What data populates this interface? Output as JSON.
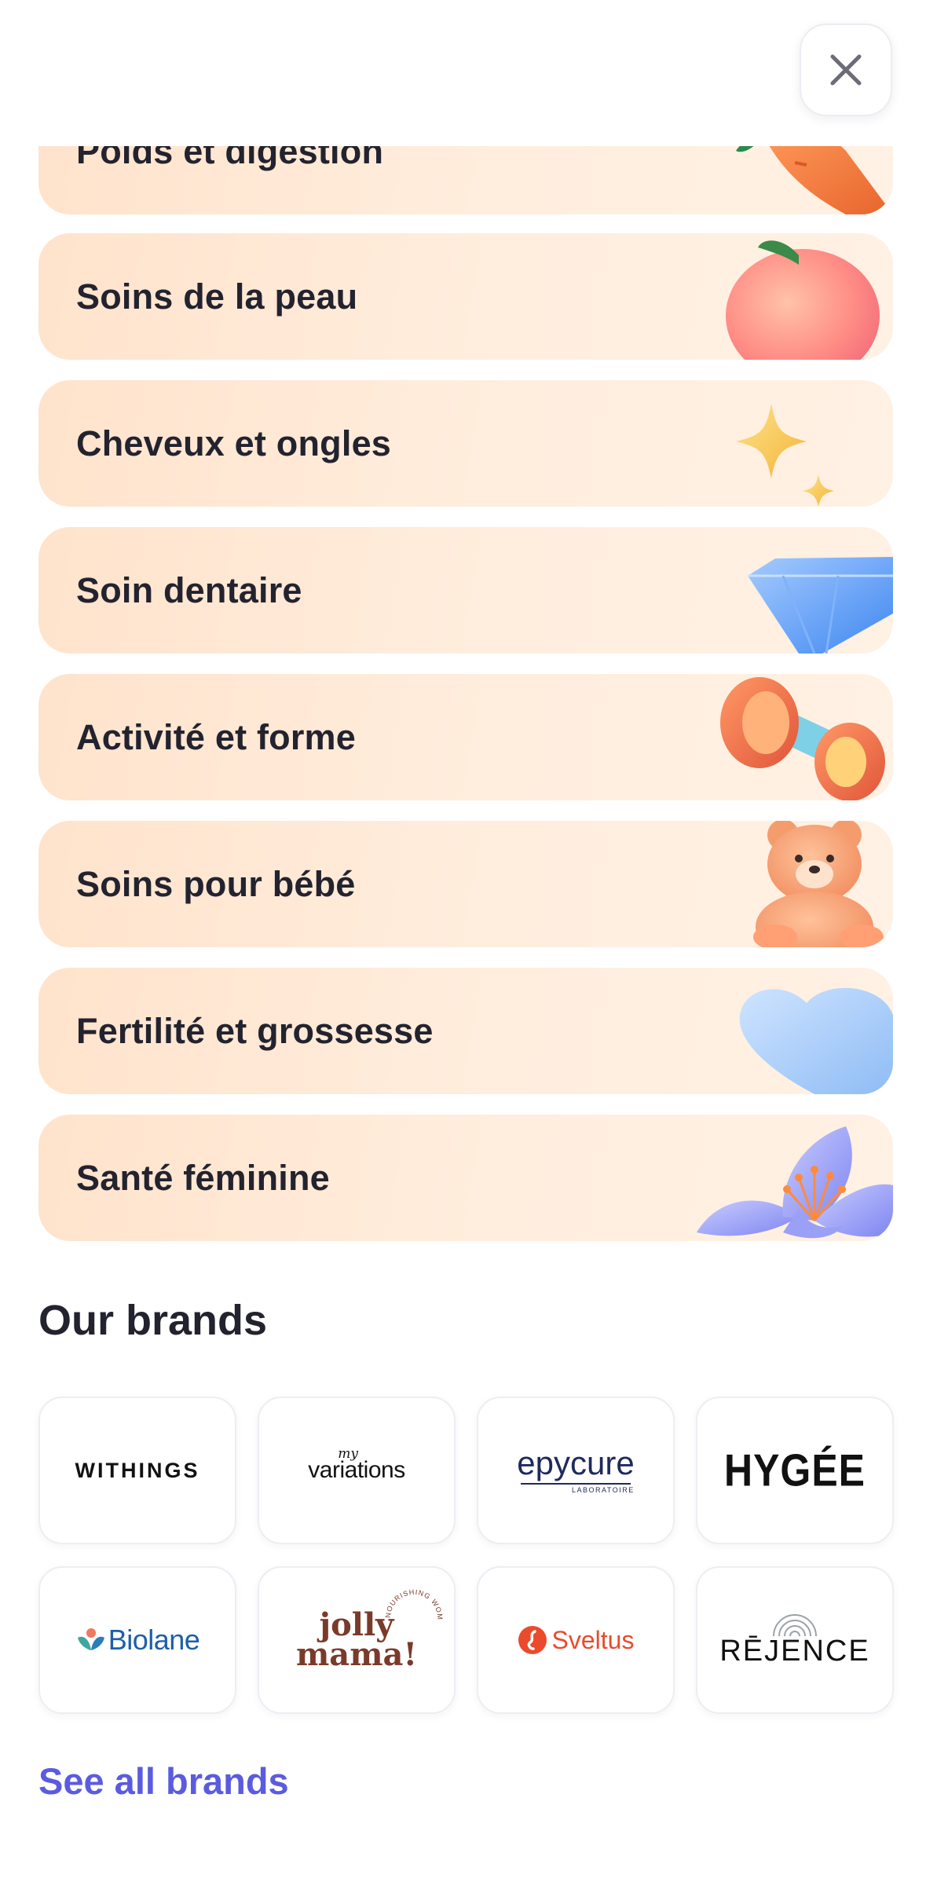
{
  "header": {
    "close_icon": "close-icon"
  },
  "categories": [
    {
      "label": "Poids et digestion",
      "icon": "carrot-icon"
    },
    {
      "label": "Soins de la peau",
      "icon": "peach-icon"
    },
    {
      "label": "Cheveux et ongles",
      "icon": "sparkle-icon"
    },
    {
      "label": "Soin dentaire",
      "icon": "diamond-icon"
    },
    {
      "label": "Activité et forme",
      "icon": "dumbbell-icon"
    },
    {
      "label": "Soins pour bébé",
      "icon": "teddy-bear-icon"
    },
    {
      "label": "Fertilité et grossesse",
      "icon": "heart-icon"
    },
    {
      "label": "Santé féminine",
      "icon": "flower-icon"
    }
  ],
  "brands": {
    "title": "Our brands",
    "items": [
      {
        "name": "WITHINGS"
      },
      {
        "name": "variations",
        "tag": "my"
      },
      {
        "name": "epycure",
        "tag": "LABORATOIRE"
      },
      {
        "name": "HYGÉE"
      },
      {
        "name": "Biolane"
      },
      {
        "name": "jolly",
        "name2": "mama!",
        "tag": "NOURISHING WOMEN"
      },
      {
        "name": "Sveltus"
      },
      {
        "name": "RĒJENCE"
      }
    ],
    "see_all": "See all brands"
  },
  "colors": {
    "card_bg": "#ffe8d4",
    "link": "#5b5be0",
    "text": "#23232f"
  }
}
